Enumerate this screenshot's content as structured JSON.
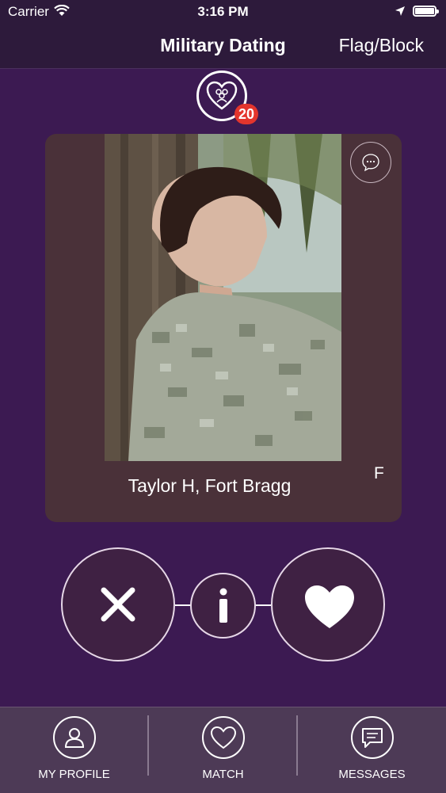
{
  "status_bar": {
    "carrier": "Carrier",
    "time": "3:16 PM"
  },
  "nav": {
    "title": "Military Dating",
    "flag_block_label": "Flag/Block"
  },
  "match_badge": {
    "count": "20"
  },
  "profile": {
    "name_location": "Taylor H, Fort Bragg",
    "gender": "F"
  },
  "actions": {
    "info_label": "i"
  },
  "tabs": [
    {
      "label": "MY PROFILE",
      "icon": "profile-icon"
    },
    {
      "label": "MATCH",
      "icon": "heart-icon"
    },
    {
      "label": "MESSAGES",
      "icon": "message-icon"
    }
  ],
  "colors": {
    "background": "#3c1a52",
    "nav_background": "#2d1a3b",
    "card_background": "#4a3139",
    "tab_background": "#4d3a56",
    "badge": "#e3352d"
  }
}
